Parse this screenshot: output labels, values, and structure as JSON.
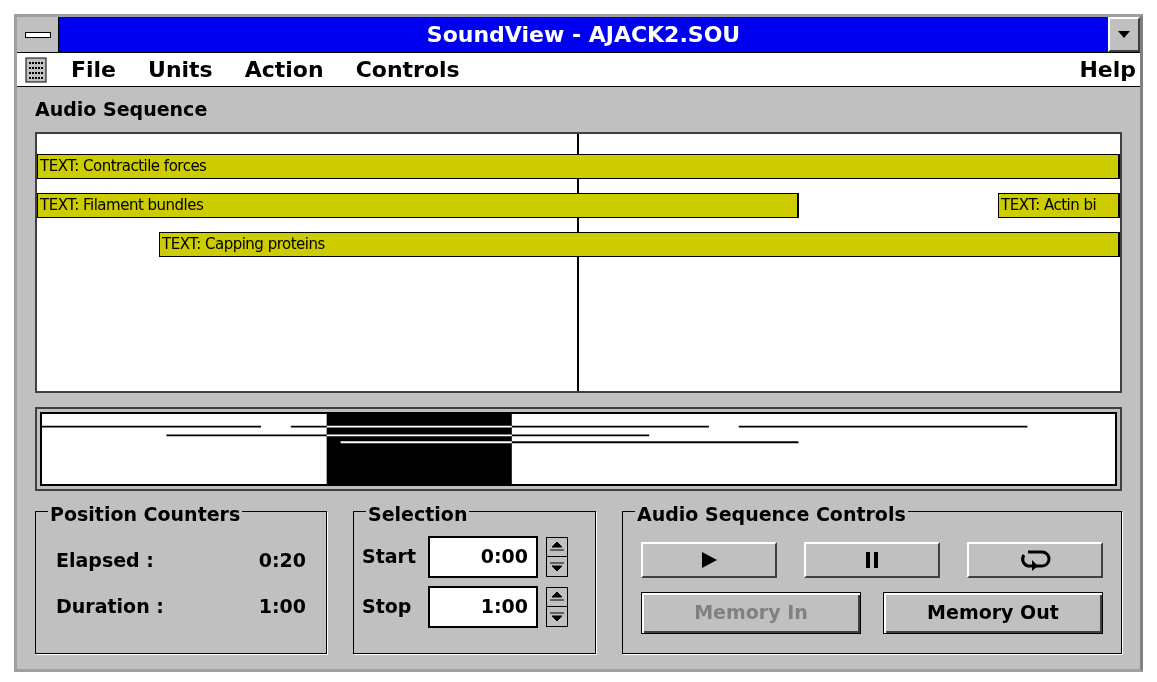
{
  "window": {
    "title": "SoundView - AJACK2.SOU"
  },
  "menu": {
    "items": [
      {
        "label": "File"
      },
      {
        "label": "Units"
      },
      {
        "label": "Action"
      },
      {
        "label": "Controls"
      }
    ],
    "help": "Help"
  },
  "sequence": {
    "title": "Audio Sequence",
    "tracks": [
      {
        "label": "TEXT: Contractile forces"
      },
      {
        "label": "TEXT: Filament bundles"
      },
      {
        "label": "TEXT: Actin bi"
      },
      {
        "label": "TEXT: Capping proteins"
      }
    ]
  },
  "position_counters": {
    "title": "Position Counters",
    "rows": [
      {
        "label": "Elapsed :",
        "value": "0:20"
      },
      {
        "label": "Duration :",
        "value": "1:00"
      }
    ]
  },
  "selection": {
    "title": "Selection",
    "fields": [
      {
        "label": "Start",
        "value": "0:00"
      },
      {
        "label": "Stop",
        "value": "1:00"
      }
    ]
  },
  "controls": {
    "title": "Audio Sequence Controls",
    "transport": [
      {
        "kind": "play"
      },
      {
        "kind": "pause"
      },
      {
        "kind": "loop"
      }
    ],
    "buttons": [
      {
        "label": "Memory In",
        "disabled": true
      },
      {
        "label": "Memory Out",
        "disabled": false
      }
    ]
  }
}
